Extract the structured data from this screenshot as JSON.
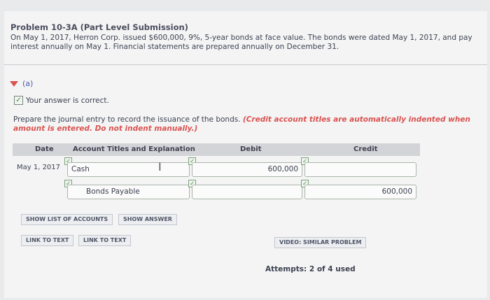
{
  "problem": {
    "title": "Problem 10-3A (Part Level Submission)",
    "text": "On May 1, 2017, Herron Corp. issued $600,000, 9%, 5-year bonds at face value. The bonds were dated May 1, 2017, and pay interest annually on May 1. Financial statements are prepared annually on December 31."
  },
  "part": {
    "label": "(a)"
  },
  "feedback": {
    "text": "Your answer is correct."
  },
  "instructions": {
    "text": "Prepare the journal entry to record the issuance of the bonds.",
    "note": "(Credit account titles are automatically indented when amount is entered. Do not indent manually.)"
  },
  "table": {
    "headers": {
      "date": "Date",
      "account": "Account Titles and Explanation",
      "debit": "Debit",
      "credit": "Credit"
    },
    "rows": [
      {
        "date": "May 1, 2017",
        "account": "Cash",
        "debit": "600,000",
        "credit": ""
      },
      {
        "date": "",
        "account": "Bonds Payable",
        "debit": "",
        "credit": "600,000"
      }
    ]
  },
  "buttons": {
    "show_accounts": "SHOW LIST OF ACCOUNTS",
    "show_answer": "SHOW ANSWER",
    "link1": "LINK TO TEXT",
    "link2": "LINK TO TEXT",
    "video": "VIDEO: SIMILAR PROBLEM"
  },
  "attempts": {
    "text": "Attempts: 2 of 4 used"
  },
  "icons": {
    "check": "check-icon",
    "caret": "caret-down-icon",
    "cursor": "text-cursor-icon"
  },
  "colors": {
    "accent_red": "#d9534f",
    "link_blue": "#4a5fa8",
    "check_green": "#3f8a3f"
  }
}
